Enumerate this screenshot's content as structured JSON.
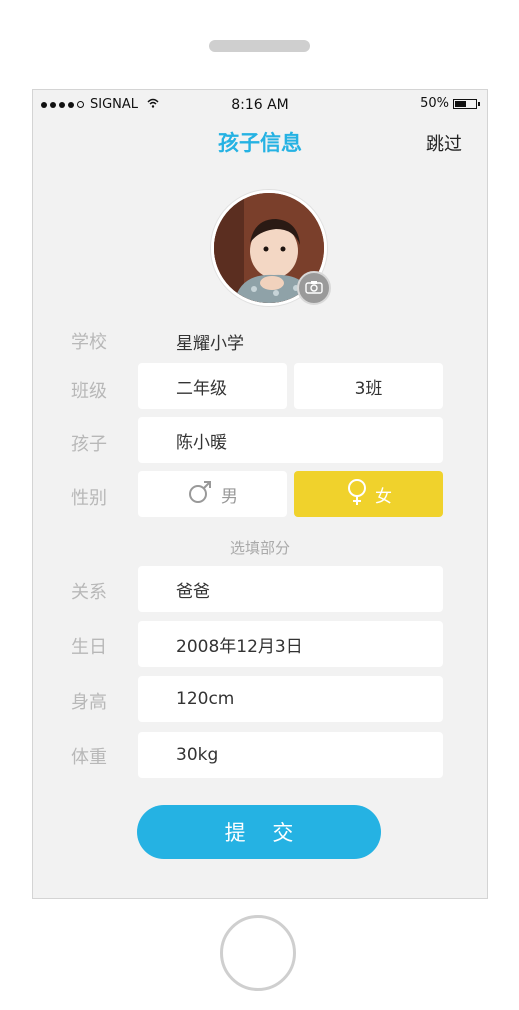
{
  "status_bar": {
    "carrier": "SIGNAL",
    "time": "8:16 AM",
    "battery": "50%"
  },
  "header": {
    "title": "孩子信息",
    "skip_label": "跳过"
  },
  "form": {
    "school": {
      "label": "学校",
      "value": "星耀小学"
    },
    "class": {
      "label": "班级",
      "grade": "二年级",
      "class_no": "3班"
    },
    "child": {
      "label": "孩子",
      "value": "陈小暖"
    },
    "gender": {
      "label": "性别",
      "male": "男",
      "female": "女",
      "selected": "女"
    },
    "optional_note": "选填部分",
    "relation": {
      "label": "关系",
      "value": "爸爸"
    },
    "birthday": {
      "label": "生日",
      "value": "2008年12月3日"
    },
    "height": {
      "label": "身高",
      "value": "120cm"
    },
    "weight": {
      "label": "体重",
      "value": "30kg"
    },
    "submit_label": "提 交"
  },
  "colors": {
    "accent": "#25b2e3",
    "female_selected": "#f0d22c",
    "background": "#f2f2f2"
  },
  "icons": [
    "camera-icon",
    "male-icon",
    "female-icon",
    "wifi-icon",
    "battery-icon"
  ]
}
